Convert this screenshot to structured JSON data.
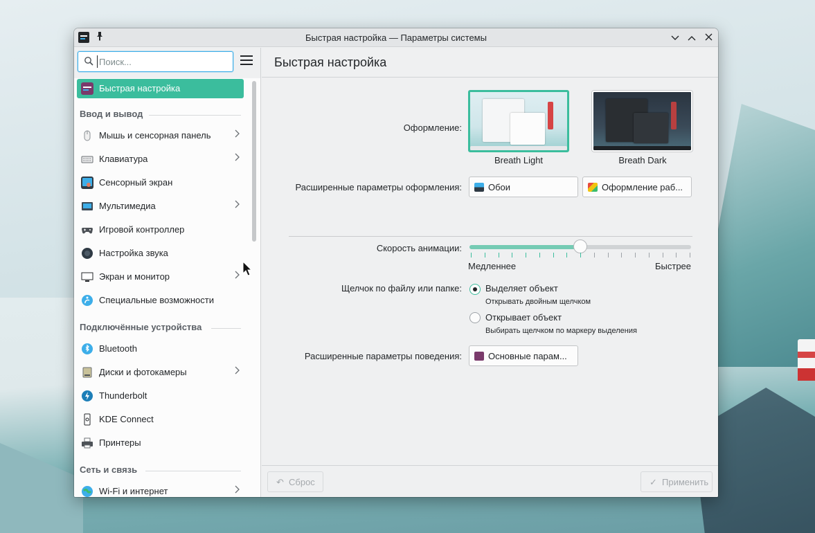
{
  "window": {
    "title": "Быстрая настройка — Параметры системы",
    "pin_icon": "pin-icon",
    "controls": {
      "minimize": "⌄",
      "maximize": "⌃",
      "close": "✕"
    }
  },
  "sidebar": {
    "search_placeholder": "Поиск...",
    "active_item": "Быстрая настройка",
    "sections": [
      {
        "title": "Ввод и вывод"
      },
      {
        "title": "Подключённые устройства"
      },
      {
        "title": "Сеть и связь"
      }
    ],
    "items": [
      {
        "label": "Быстрая настройка",
        "icon": "quick-settings-icon",
        "has_children": false
      },
      {
        "label": "Мышь и сенсорная панель",
        "icon": "mouse-icon",
        "has_children": true
      },
      {
        "label": "Клавиатура",
        "icon": "keyboard-icon",
        "has_children": true
      },
      {
        "label": "Сенсорный экран",
        "icon": "touchscreen-icon",
        "has_children": false
      },
      {
        "label": "Мультимедиа",
        "icon": "multimedia-icon",
        "has_children": true
      },
      {
        "label": "Игровой контроллер",
        "icon": "gamepad-icon",
        "has_children": false
      },
      {
        "label": "Настройка звука",
        "icon": "audio-icon",
        "has_children": false
      },
      {
        "label": "Экран и монитор",
        "icon": "monitor-icon",
        "has_children": true
      },
      {
        "label": "Специальные возможности",
        "icon": "accessibility-icon",
        "has_children": false
      },
      {
        "label": "Bluetooth",
        "icon": "bluetooth-icon",
        "has_children": false
      },
      {
        "label": "Диски и фотокамеры",
        "icon": "disk-icon",
        "has_children": true
      },
      {
        "label": "Thunderbolt",
        "icon": "thunderbolt-icon",
        "has_children": false
      },
      {
        "label": "KDE Connect",
        "icon": "kde-connect-icon",
        "has_children": false
      },
      {
        "label": "Принтеры",
        "icon": "printer-icon",
        "has_children": false
      },
      {
        "label": "Wi-Fi и интернет",
        "icon": "wifi-globe-icon",
        "has_children": true
      }
    ]
  },
  "main": {
    "title": "Быстрая настройка",
    "appearance_label": "Оформление:",
    "themes": [
      {
        "name": "Breath Light",
        "selected": true
      },
      {
        "name": "Breath Dark",
        "selected": false
      }
    ],
    "advanced_appearance_label": "Расширенные параметры оформления:",
    "wallpaper_button": "Обои",
    "workspace_theme_button": "Оформление раб...",
    "animation_speed_label": "Скорость анимации:",
    "animation_speed": {
      "value_fraction": 0.5,
      "min_label": "Медленнее",
      "max_label": "Быстрее"
    },
    "click_behavior_label": "Щелчок по файлу или папке:",
    "click_options": [
      {
        "label": "Выделяет объект",
        "hint": "Открывать двойным щелчком",
        "selected": true
      },
      {
        "label": "Открывает объект",
        "hint": "Выбирать щелчком по маркеру выделения",
        "selected": false
      }
    ],
    "advanced_behavior_label": "Расширенные параметры поведения:",
    "general_behavior_button": "Основные парам...",
    "reset_button": "Сброс",
    "apply_button": "Применить"
  },
  "colors": {
    "accent": "#3bbd9d",
    "selection_focus": "#3daee9",
    "window_bg": "#eff0f1",
    "text": "#232629"
  }
}
